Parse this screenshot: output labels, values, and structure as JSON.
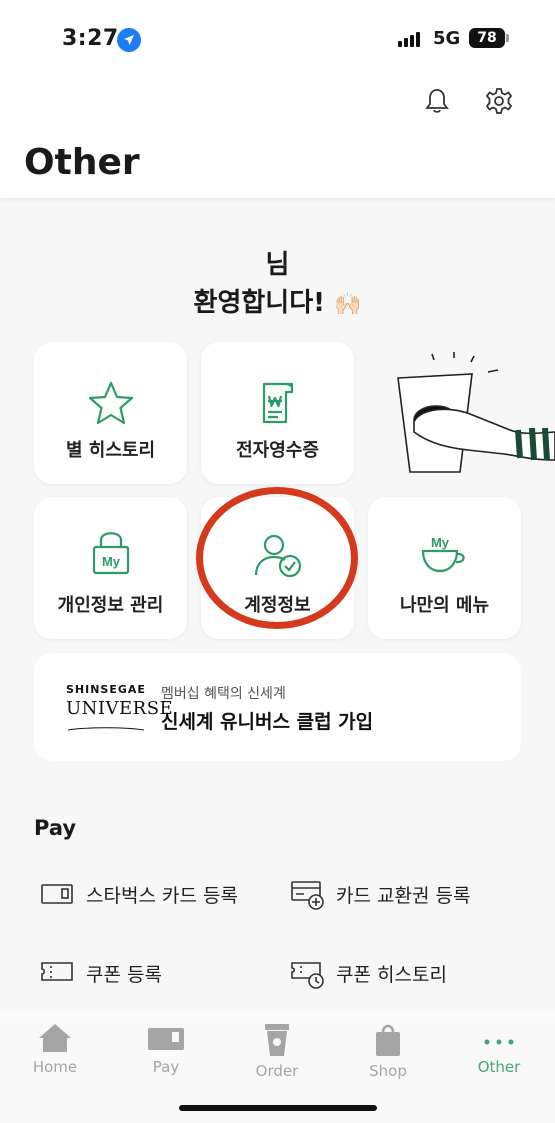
{
  "status": {
    "time": "3:27",
    "network": "5G",
    "battery": "78"
  },
  "header": {
    "title": "Other"
  },
  "welcome": {
    "line1": "님",
    "line2": "환영합니다!",
    "emoji": "🙌🏻"
  },
  "tiles": {
    "star_history": "별 히스토리",
    "receipt": "전자영수증",
    "privacy": "개인정보 관리",
    "account": "계정정보",
    "my_menu": "나만의 메뉴",
    "lock_badge": "My",
    "cup_badge": "My"
  },
  "universe": {
    "logo_top": "SHINSEGAE",
    "logo_main": "UNIVERSE",
    "subtitle": "멤버십 혜택의 신세계",
    "title": "신세계 유니버스 클럽 가입"
  },
  "pay": {
    "title": "Pay",
    "items": [
      {
        "label": "스타벅스 카드 등록",
        "icon": "card-icon"
      },
      {
        "label": "카드 교환권 등록",
        "icon": "card-plus-icon"
      },
      {
        "label": "쿠폰 등록",
        "icon": "coupon-icon"
      },
      {
        "label": "쿠폰 히스토리",
        "icon": "coupon-history-icon"
      }
    ]
  },
  "tabbar": {
    "home": "Home",
    "pay": "Pay",
    "order": "Order",
    "shop": "Shop",
    "other": "Other",
    "active": "Other"
  },
  "colors": {
    "accent_green": "#2e9a6a",
    "highlight_red": "#d63a1c"
  }
}
